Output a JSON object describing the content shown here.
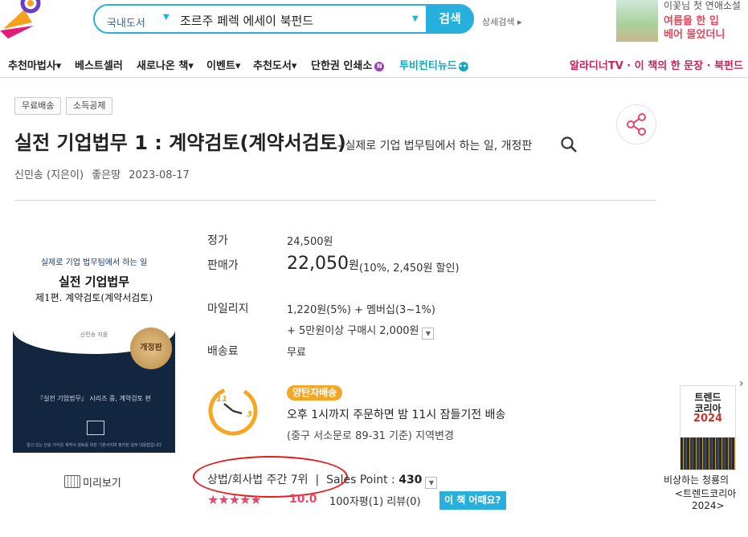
{
  "header": {
    "search": {
      "category": "국내도서",
      "query": "조르주 페렉 에세이 북펀드",
      "button_label": "검색",
      "advanced_label": "상세검색 ▸"
    },
    "promo": {
      "line1": "이꽃님 첫 연애소설",
      "line2": "여름을 한 입",
      "line3": "베어 물었더니"
    }
  },
  "nav": {
    "items": [
      "추천마법사▾",
      "베스트셀러",
      "새로나온 책▾",
      "이벤트▾",
      "추천도서▾",
      "단한권 인쇄소"
    ],
    "teal_item": "투비컨티뉴드",
    "right_link": "알라디너TV · 이 책의 한 문장 · 북펀드"
  },
  "tags": [
    "무료배송",
    "소득공제"
  ],
  "book": {
    "title": "실전 기업법무 1 : 계약검토(계약서검토)",
    "subtitle": "- 실제로 기업 법무팀에서 하는 일, 개정판",
    "author": "신민송 (지은이)",
    "publisher": "좋은땅",
    "date": "2023-08-17",
    "cover": {
      "sub": "실제로 기업 법무팀에서 하는 일",
      "title1": "실전 기업법무",
      "title2": "제1편. 계약검토(계약서검토)",
      "author": "신민송 지음",
      "seal": "개정판",
      "series": "『실전 기업법무』 시리즈 중, 계약검토 편",
      "footer": "알고 있는 단순 지식은 계약서 검토를 위한 기본서이며 정리된 실무 대응법입니다"
    },
    "preview_label": "미리보기"
  },
  "price": {
    "list_label": "정가",
    "list_value": "24,500원",
    "sale_label": "판매가",
    "sale_value": "22,050",
    "sale_unit": "원",
    "sale_discount": "(10%, 2,450원 할인)",
    "mileage_label": "마일리지",
    "mileage_line1": "1,220원(5%) + 멤버십(3~1%)",
    "mileage_line2": "+ 5만원이상 구매시 2,000원",
    "shipping_label": "배송료",
    "shipping_value": "무료"
  },
  "delivery": {
    "badge": "양탄자배송",
    "line1": "오후 1시까지 주문하면 밤 11시 잠들기전 배송",
    "line2": "(중구 서소문로 89-31 기준) 지역변경",
    "clock_11": "11",
    "clock_3": "3"
  },
  "ranking": {
    "text": "상법/회사법 주간 7위",
    "sales_label": "Sales Point :",
    "sales_value": "430"
  },
  "rating": {
    "stars": "★★★★★",
    "score": "10.0",
    "reviews": "100자평(1)  리뷰(0)",
    "ask_button": "이 책 어때요?"
  },
  "side_ad": {
    "cover_line1": "트렌드",
    "cover_line2": "코리아",
    "cover_line3": "2024",
    "caption1": "비상하는 청룡의",
    "caption2": "<트렌드코리아",
    "caption3": "2024>",
    "close": "›"
  },
  "colors": {
    "accent": "#27b0dc",
    "pink": "#e8466b",
    "orange": "#f5a623",
    "nav_pink": "#c8245e",
    "teal": "#14a8b8"
  }
}
